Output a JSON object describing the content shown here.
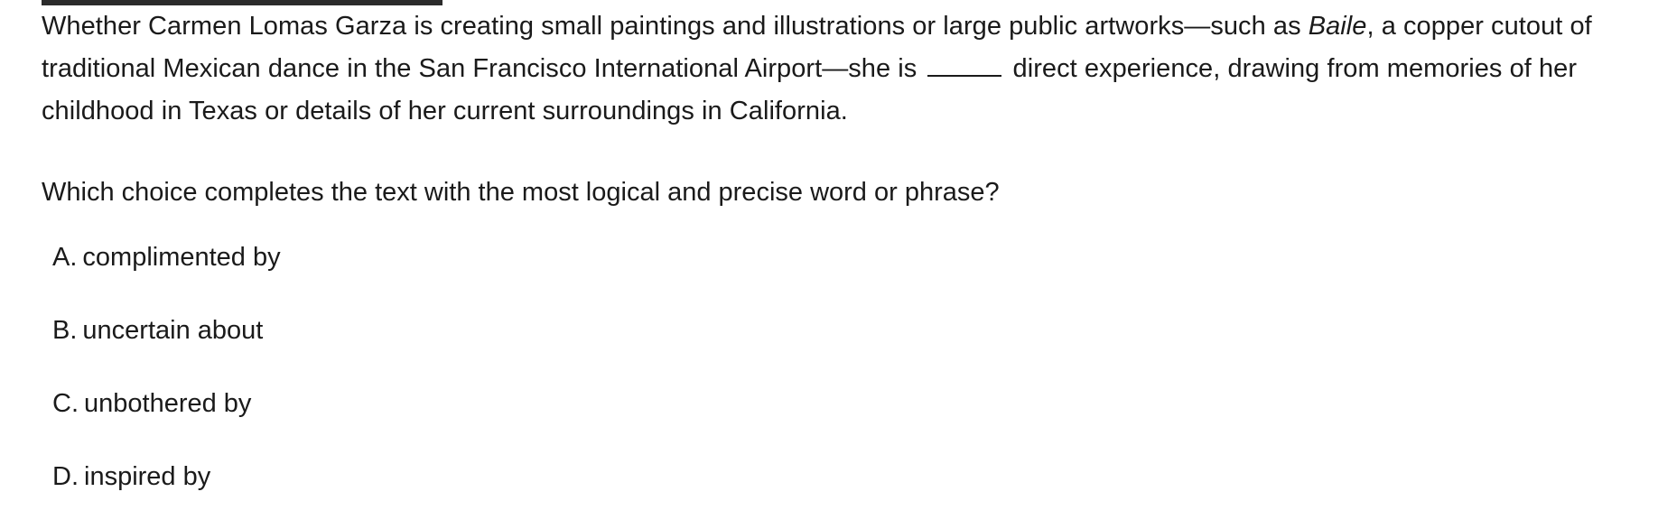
{
  "passage": {
    "part1": "Whether Carmen Lomas Garza is creating small paintings and illustrations or large public artworks—such as ",
    "title_italic": "Baile",
    "part2": ", a copper cutout of traditional Mexican dance in the San Francisco International Airport—she is ",
    "part3": " direct experience, drawing from memories of her childhood in Texas or details of her current surroundings in California."
  },
  "question": "Which choice completes the text with the most logical and precise word or phrase?",
  "choices": [
    {
      "letter": "A.",
      "text": "complimented by"
    },
    {
      "letter": "B.",
      "text": "uncertain about"
    },
    {
      "letter": "C.",
      "text": "unbothered by"
    },
    {
      "letter": "D.",
      "text": "inspired by"
    }
  ]
}
